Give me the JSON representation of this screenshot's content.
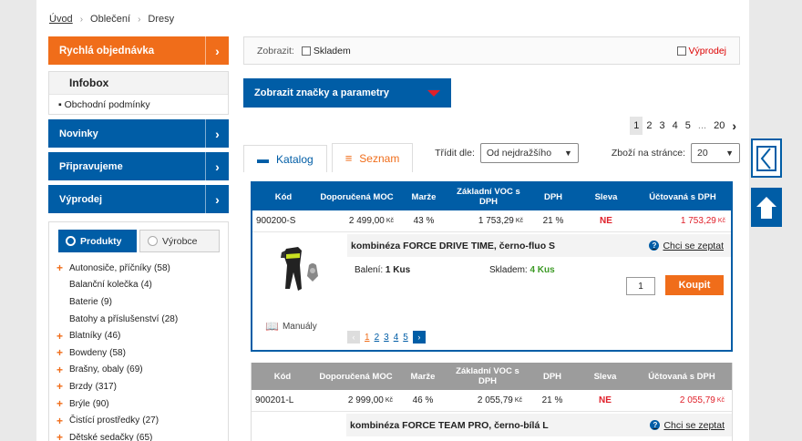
{
  "breadcrumb": [
    "Úvod",
    "Oblečení",
    "Dresy"
  ],
  "sidebar": {
    "quick_order": "Rychlá objednávka",
    "infobox_title": "Infobox",
    "infobox_items": [
      "Obchodní podmínky"
    ],
    "nav": [
      "Novinky",
      "Připravujeme",
      "Výprodej"
    ],
    "toggle": [
      "Produkty",
      "Výrobce"
    ],
    "categories": [
      {
        "name": "Autonosiče, příčníky",
        "count": "(58)",
        "plus": true
      },
      {
        "name": "Balanční kolečka",
        "count": "(4)",
        "plus": false
      },
      {
        "name": "Baterie",
        "count": "(9)",
        "plus": false
      },
      {
        "name": "Batohy a příslušenství",
        "count": "(28)",
        "plus": false
      },
      {
        "name": "Blatníky",
        "count": "(46)",
        "plus": true
      },
      {
        "name": "Bowdeny",
        "count": "(58)",
        "plus": true
      },
      {
        "name": "Brašny, obaly",
        "count": "(69)",
        "plus": true
      },
      {
        "name": "Brzdy",
        "count": "(317)",
        "plus": true
      },
      {
        "name": "Brýle",
        "count": "(90)",
        "plus": true
      },
      {
        "name": "Čistící prostředky",
        "count": "(27)",
        "plus": true
      },
      {
        "name": "Dětské sedačky",
        "count": "(65)",
        "plus": true
      }
    ]
  },
  "filter": {
    "label": "Zobrazit:",
    "in_stock": "Skladem",
    "sale": "Výprodej"
  },
  "brands_button": "Zobrazit značky a parametry",
  "pager": [
    "1",
    "2",
    "3",
    "4",
    "5",
    "...",
    "20"
  ],
  "tabs": {
    "catalog": "Katalog",
    "list": "Seznam"
  },
  "sort": {
    "label": "Třídit dle:",
    "value": "Od nejdražšího",
    "per_page_label": "Zboží na stránce:",
    "per_page": "20"
  },
  "columns": [
    "Kód",
    "Doporučená MOC",
    "Marže",
    "Základní VOC s DPH",
    "DPH",
    "Sleva",
    "Účtovaná s DPH"
  ],
  "currency": "Kč",
  "products": [
    {
      "code": "900200-S",
      "moc": "2 499,00",
      "margin": "43 %",
      "voc": "1 753,29",
      "vat": "21 %",
      "discount": "NE",
      "price": "1 753,29",
      "name": "kombinéza FORCE DRIVE TIME, černo-fluo S",
      "ask": "Chci se zeptat",
      "pack_label": "Balení:",
      "pack": "1 Kus",
      "stock_label": "Skladem:",
      "stock": "4 Kus",
      "qty": "1",
      "buy": "Koupit",
      "manuals": "Manuály",
      "img_pages": [
        "1",
        "2",
        "3",
        "4",
        "5"
      ]
    },
    {
      "code": "900201-L",
      "moc": "2 999,00",
      "margin": "46 %",
      "voc": "2 055,79",
      "vat": "21 %",
      "discount": "NE",
      "price": "2 055,79",
      "name": "kombinéza FORCE TEAM PRO, černo-bílá L",
      "ask": "Chci se zeptat"
    }
  ],
  "colors": {
    "brand_blue": "#005da6",
    "accent_orange": "#f06d1a",
    "red": "#e0202a"
  }
}
